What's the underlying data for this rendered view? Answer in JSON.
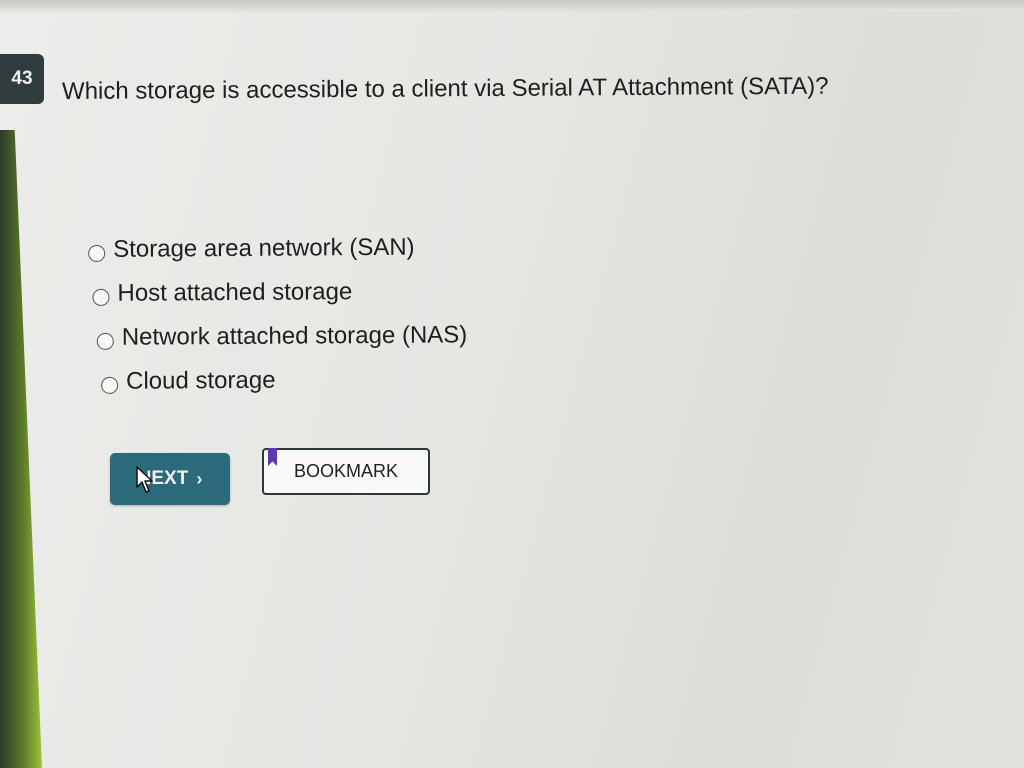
{
  "question": {
    "number": "43",
    "text": "Which storage is accessible to a client via Serial AT Attachment (SATA)?"
  },
  "options": [
    {
      "label": "Storage area network (SAN)",
      "selected": false
    },
    {
      "label": "Host attached storage",
      "selected": false
    },
    {
      "label": "Network attached storage (NAS)",
      "selected": false
    },
    {
      "label": "Cloud storage",
      "selected": false
    }
  ],
  "buttons": {
    "next_label": "NEXT",
    "next_chevron": "›",
    "bookmark_label": "BOOKMARK"
  },
  "colors": {
    "next_button_bg": "#2a6a7a",
    "bookmark_flag": "#5b3ab0",
    "question_badge_bg": "#2f3b3c"
  },
  "icons": {
    "cursor": "mouse-pointer-icon",
    "bookmark": "bookmark-flag-icon",
    "next": "chevron-right-icon"
  }
}
